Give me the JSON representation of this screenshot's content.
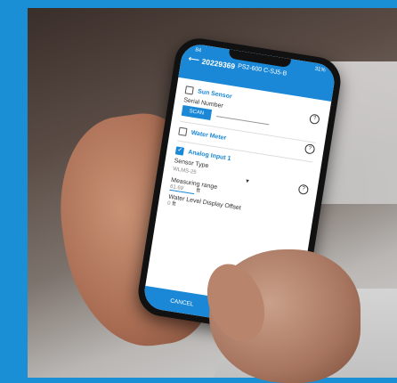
{
  "status": {
    "left": "84",
    "battery": "31%"
  },
  "appbar": {
    "serial": "20229369",
    "model": "PS2-600 C-SJ5-B"
  },
  "sections": {
    "sun_sensor": {
      "label": "Sun Sensor",
      "checked": false
    },
    "serial_number": {
      "label": "Serial Number",
      "scan_label": "SCAN"
    },
    "water_meter": {
      "label": "Water Meter",
      "checked": false
    },
    "analog_input": {
      "label": "Analog Input 1",
      "checked": true
    }
  },
  "sensor": {
    "type_label": "Sensor Type",
    "type_value": "WLMS-25",
    "range_label": "Measuring range",
    "range_value": "61.69",
    "range_unit": "ft",
    "offset_label": "Water Level Display Offset",
    "offset_value": "0",
    "offset_unit": "ft"
  },
  "buttons": {
    "cancel": "CANCEL",
    "save": "S"
  },
  "help_icon_glyph": "?"
}
